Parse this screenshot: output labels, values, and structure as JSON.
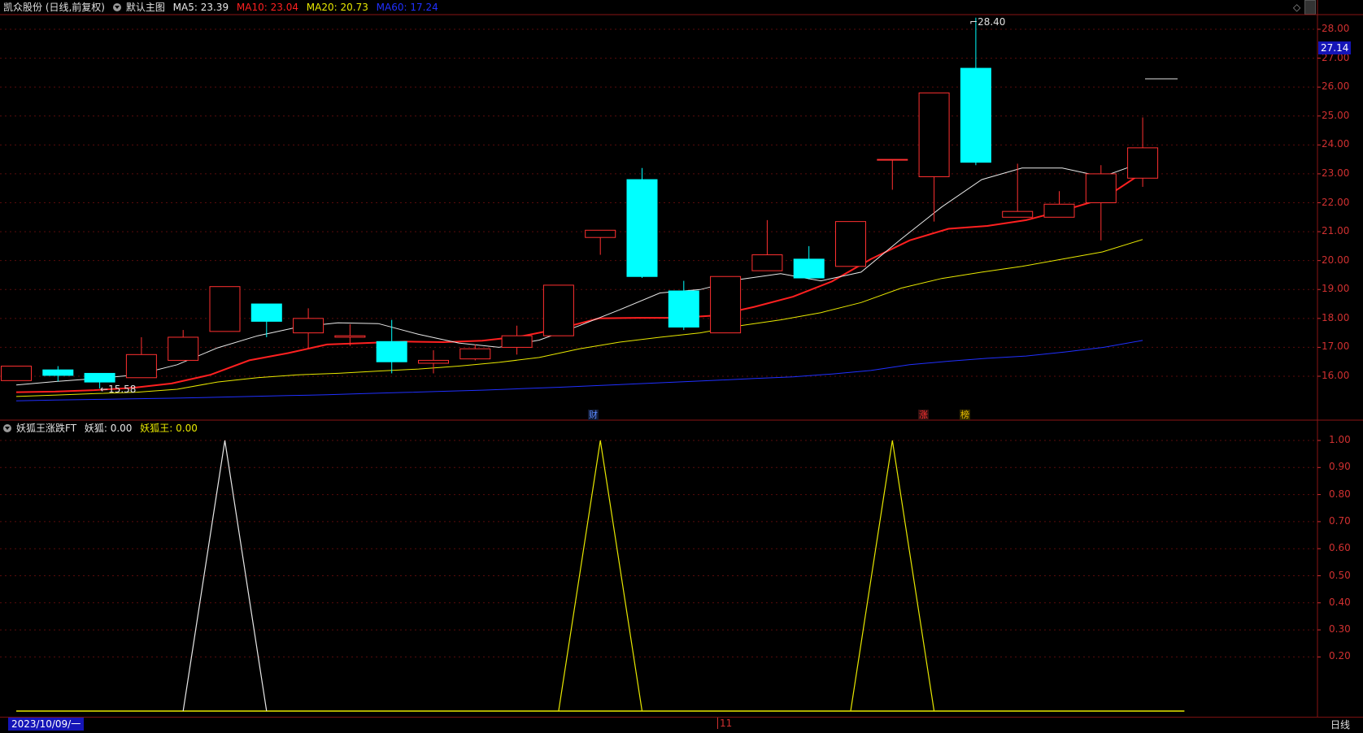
{
  "header": {
    "stock": "凯众股份 (日线,前复权)",
    "main_indicator": "默认主图",
    "ma5": "MA5: 23.39",
    "ma10": "MA10: 23.04",
    "ma20": "MA20: 20.73",
    "ma60": "MA60: 17.24",
    "colors": {
      "ma5": "#e8e8e8",
      "ma10": "#ff2020",
      "ma20": "#e8e800",
      "ma60": "#2030ff",
      "up": "#ff3030",
      "down": "#00ffff"
    }
  },
  "sub_header": {
    "indicator": "妖狐王涨跌FT",
    "yaohu": "妖狐: 0.00",
    "yaohuwang": "妖狐王: 0.00"
  },
  "price_axis": {
    "ticks": [
      "28.00",
      "27.00",
      "26.00",
      "25.00",
      "24.00",
      "23.00",
      "22.00",
      "21.00",
      "20.00",
      "19.00",
      "18.00",
      "17.00",
      "16.00"
    ],
    "current": "27.14"
  },
  "sub_axis": {
    "ticks": [
      "1.00",
      "0.90",
      "0.80",
      "0.70",
      "0.60",
      "0.50",
      "0.40",
      "0.30",
      "0.20"
    ]
  },
  "labels": {
    "max": "28.40",
    "min": "15.58",
    "date": "2023/10/09/一",
    "month": "11",
    "period": "日线"
  },
  "event_marks": [
    {
      "text": "财",
      "color": "#5a8aff"
    },
    {
      "text": "涨",
      "color": "#ff3030"
    },
    {
      "text": "榜",
      "color": "#e8c000"
    }
  ],
  "chart_data": {
    "type": "candlestick",
    "ylim": [
      15.3,
      28.8
    ],
    "candles": [
      {
        "o": 15.85,
        "c": 16.35,
        "h": 16.35,
        "l": 15.85
      },
      {
        "o": 16.22,
        "c": 16.03,
        "h": 16.35,
        "l": 15.82
      },
      {
        "o": 16.1,
        "c": 15.8,
        "h": 16.1,
        "l": 15.58
      },
      {
        "o": 15.95,
        "c": 16.75,
        "h": 17.35,
        "l": 15.95
      },
      {
        "o": 16.55,
        "c": 17.35,
        "h": 17.6,
        "l": 16.55
      },
      {
        "o": 17.55,
        "c": 19.1,
        "h": 19.1,
        "l": 17.55
      },
      {
        "o": 18.5,
        "c": 17.9,
        "h": 18.5,
        "l": 17.35
      },
      {
        "o": 17.5,
        "c": 18.0,
        "h": 18.35,
        "l": 16.95
      },
      {
        "o": 17.35,
        "c": 17.4,
        "h": 17.8,
        "l": 17.05
      },
      {
        "o": 17.2,
        "c": 16.5,
        "h": 17.95,
        "l": 16.1
      },
      {
        "o": 16.45,
        "c": 16.55,
        "h": 16.9,
        "l": 16.1
      },
      {
        "o": 16.6,
        "c": 16.95,
        "h": 17.1,
        "l": 16.55
      },
      {
        "o": 17.0,
        "c": 17.4,
        "h": 17.75,
        "l": 16.75
      },
      {
        "o": 17.4,
        "c": 19.15,
        "h": 19.15,
        "l": 17.4
      },
      {
        "o": 20.8,
        "c": 21.05,
        "h": 21.05,
        "l": 20.2
      },
      {
        "o": 22.8,
        "c": 19.45,
        "h": 23.2,
        "l": 19.4
      },
      {
        "o": 18.95,
        "c": 17.7,
        "h": 19.3,
        "l": 17.6
      },
      {
        "o": 17.5,
        "c": 19.45,
        "h": 19.45,
        "l": 17.5
      },
      {
        "o": 19.65,
        "c": 20.2,
        "h": 21.4,
        "l": 19.65
      },
      {
        "o": 20.05,
        "c": 19.4,
        "h": 20.5,
        "l": 19.35
      },
      {
        "o": 19.8,
        "c": 21.35,
        "h": 21.35,
        "l": 19.8
      },
      {
        "o": 23.5,
        "c": 23.5,
        "h": 23.5,
        "l": 22.45
      },
      {
        "o": 22.9,
        "c": 25.8,
        "h": 25.8,
        "l": 21.35
      },
      {
        "o": 26.65,
        "c": 23.4,
        "h": 28.4,
        "l": 23.3
      },
      {
        "o": 21.5,
        "c": 21.7,
        "h": 23.35,
        "l": 21.5
      },
      {
        "o": 21.5,
        "c": 21.95,
        "h": 22.4,
        "l": 21.5
      },
      {
        "o": 22.0,
        "c": 23.0,
        "h": 23.3,
        "l": 20.7
      },
      {
        "o": 22.85,
        "c": 23.9,
        "h": 24.95,
        "l": 22.55
      }
    ],
    "ma5": [
      15.7,
      15.82,
      15.92,
      16.05,
      16.4,
      16.98,
      17.4,
      17.7,
      17.85,
      17.82,
      17.45,
      17.15,
      17.0,
      17.25,
      17.75,
      18.3,
      18.88,
      19.0,
      19.35,
      19.55,
      19.3,
      19.6,
      20.75,
      21.85,
      22.8,
      23.2,
      23.2,
      22.9,
      23.4
    ],
    "ma10": [
      15.45,
      15.47,
      15.52,
      15.6,
      15.75,
      16.05,
      16.55,
      16.8,
      17.1,
      17.15,
      17.2,
      17.18,
      17.23,
      17.38,
      17.65,
      18.0,
      18.02,
      18.02,
      18.1,
      18.4,
      18.75,
      19.28,
      20.05,
      20.7,
      21.1,
      21.2,
      21.4,
      21.75,
      22.15,
      23.04
    ],
    "ma20": [
      15.3,
      15.35,
      15.4,
      15.45,
      15.55,
      15.8,
      15.95,
      16.05,
      16.1,
      16.18,
      16.25,
      16.35,
      16.48,
      16.65,
      16.95,
      17.18,
      17.35,
      17.5,
      17.75,
      17.95,
      18.2,
      18.55,
      19.05,
      19.38,
      19.6,
      19.8,
      20.05,
      20.3,
      20.73
    ],
    "ma60": [
      15.15,
      15.18,
      15.2,
      15.22,
      15.24,
      15.27,
      15.3,
      15.33,
      15.36,
      15.4,
      15.44,
      15.48,
      15.52,
      15.57,
      15.62,
      15.68,
      15.74,
      15.8,
      15.86,
      15.92,
      15.98,
      16.08,
      16.2,
      16.4,
      16.52,
      16.62,
      16.7,
      16.84,
      17.0,
      17.24
    ],
    "sub": {
      "ylim": [
        0,
        1.0
      ],
      "white_peak_index": 5,
      "yellow_peak_indices": [
        14,
        21
      ]
    }
  }
}
